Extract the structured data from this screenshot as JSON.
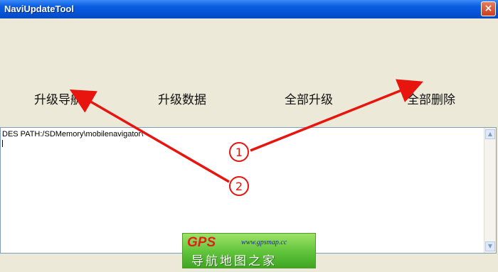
{
  "window": {
    "title": "NaviUpdateTool",
    "close_label": "×"
  },
  "buttons": {
    "upgrade_nav": "升级导航",
    "upgrade_data": "升级数据",
    "upgrade_all": "全部升级",
    "delete_all": "全部删除"
  },
  "output": {
    "text": "DES PATH:/SDMemory\\mobilenavigator\\"
  },
  "scrollbar": {
    "up_arrow": "▲",
    "down_arrow": "▼"
  },
  "annotations": {
    "callout_1": "1",
    "callout_2": "2",
    "arrow_color": "#e8140e"
  },
  "watermark": {
    "brand": "GPS",
    "url": "www.gpsmap.cc",
    "slogan": "导航地图之家"
  }
}
